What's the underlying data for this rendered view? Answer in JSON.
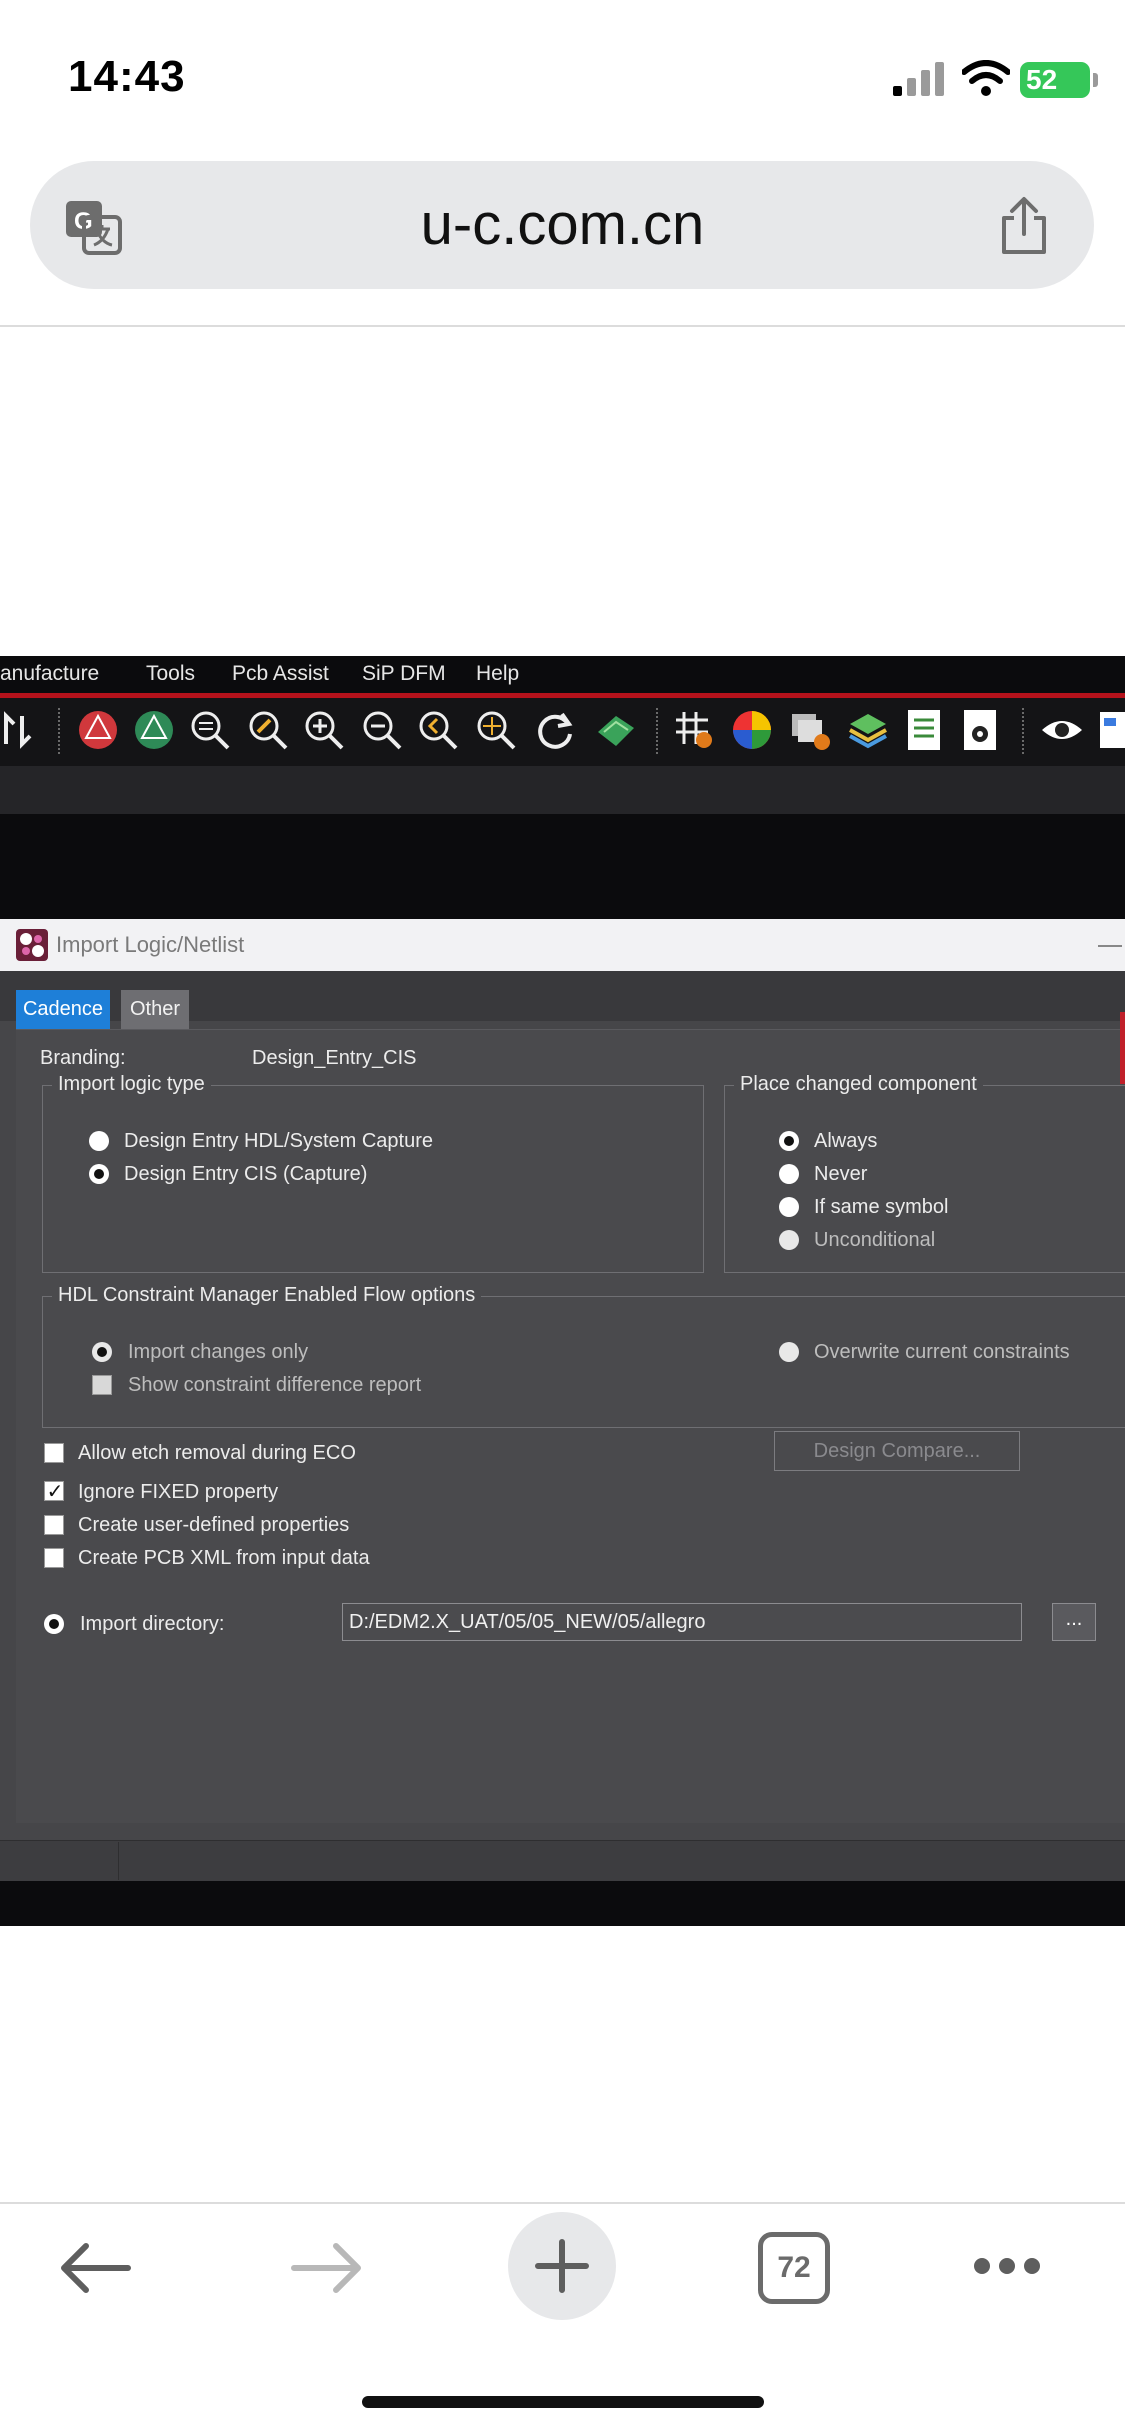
{
  "status": {
    "time": "14:43",
    "battery": "52"
  },
  "browser": {
    "url": "u-c.com.cn",
    "tab_count": "72"
  },
  "menubar": {
    "items": [
      "anufacture",
      "Tools",
      "Pcb Assist",
      "SiP DFM",
      "Help"
    ]
  },
  "toolbar": {
    "icons": [
      "sort-arrows-icon",
      "rats-icon",
      "unrats-icon",
      "zoom-fit-icon",
      "zoom-edit-icon",
      "zoom-in-icon",
      "zoom-out-icon",
      "zoom-previous-icon",
      "zoom-center-icon",
      "redraw-icon",
      "3d-view-icon",
      "grid-icon",
      "color-icon",
      "shadow-icon",
      "layers-icon",
      "report-icon",
      "settings-icon",
      "visibility-icon",
      "panel-icon"
    ]
  },
  "dialog": {
    "title": "Import Logic/Netlist",
    "tabs": [
      "Cadence",
      "Other"
    ],
    "branding_label": "Branding:",
    "branding_value": "Design_Entry_CIS",
    "import_logic_type": {
      "legend": "Import logic type",
      "options": [
        "Design Entry HDL/System Capture",
        "Design Entry CIS (Capture)"
      ],
      "selected": "Design Entry CIS (Capture)"
    },
    "place_changed_component": {
      "legend": "Place changed component",
      "options": [
        "Always",
        "Never",
        "If same symbol",
        "Unconditional"
      ],
      "selected": "Always"
    },
    "hdl_constraint": {
      "legend": "HDL Constraint Manager Enabled Flow options",
      "import_changes_only": "Import changes only",
      "overwrite_current": "Overwrite current constraints",
      "show_difference": "Show constraint difference report"
    },
    "checkboxes": [
      {
        "label": "Allow etch removal during ECO",
        "checked": false
      },
      {
        "label": "Ignore FIXED property",
        "checked": true
      },
      {
        "label": "Create user-defined properties",
        "checked": false
      },
      {
        "label": "Create PCB XML from input data",
        "checked": false
      }
    ],
    "design_compare": "Design Compare...",
    "import_directory_label": "Import directory:",
    "import_directory_value": "D:/EDM2.X_UAT/05/05_NEW/05/allegro",
    "browse": "..."
  }
}
